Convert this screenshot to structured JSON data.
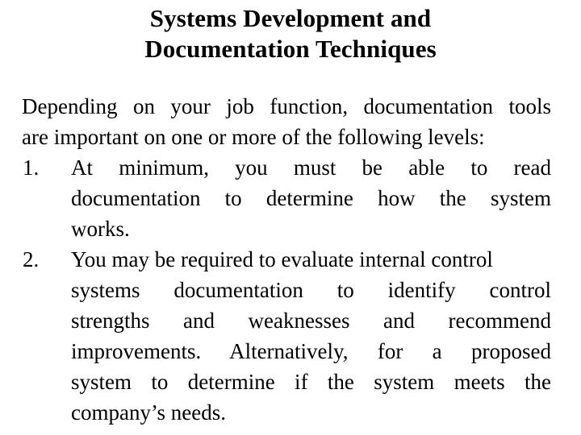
{
  "slide": {
    "title_lines": [
      "Systems Development and",
      "Documentation Techniques"
    ],
    "intro_lines": [
      "Depending on your job function, documentation tools",
      "are important on one or more of the following levels:"
    ],
    "list": [
      {
        "marker": "1.",
        "lines": [
          "At minimum, you must be able to read",
          "documentation to determine how the system",
          "works."
        ]
      },
      {
        "marker": "2.",
        "lines": [
          "You may be required to evaluate internal control",
          "systems documentation to identify control",
          "strengths and weaknesses and recommend",
          "improvements. Alternatively, for a proposed",
          "system to determine if the system meets the",
          "company’s needs."
        ]
      }
    ],
    "colors": {
      "background": "#ffffff",
      "text": "#000000"
    }
  }
}
